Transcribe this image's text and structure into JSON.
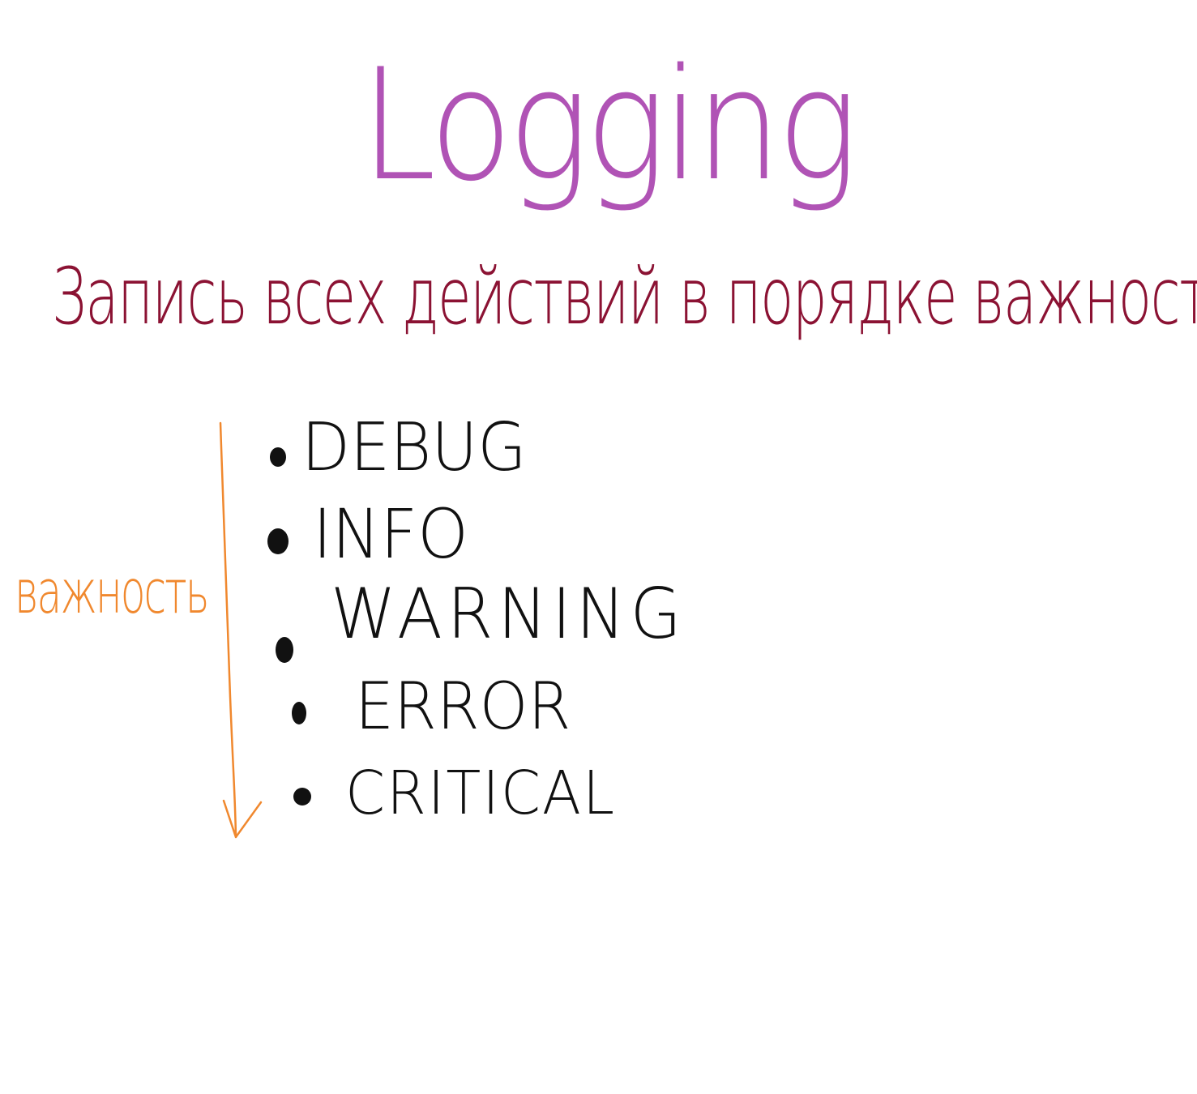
{
  "title": "Logging",
  "subtitle": "Запись всех действий в порядке важности",
  "axis_label": "важность",
  "levels": [
    {
      "label": "DEBUG"
    },
    {
      "label": "INFO"
    },
    {
      "label": "WARNING"
    },
    {
      "label": "ERROR"
    },
    {
      "label": "CRITICAL"
    }
  ],
  "colors": {
    "title": "#b053b5",
    "subtitle": "#8b1233",
    "axis": "#f0882e",
    "levels": "#111111",
    "background": "#ffffff"
  }
}
